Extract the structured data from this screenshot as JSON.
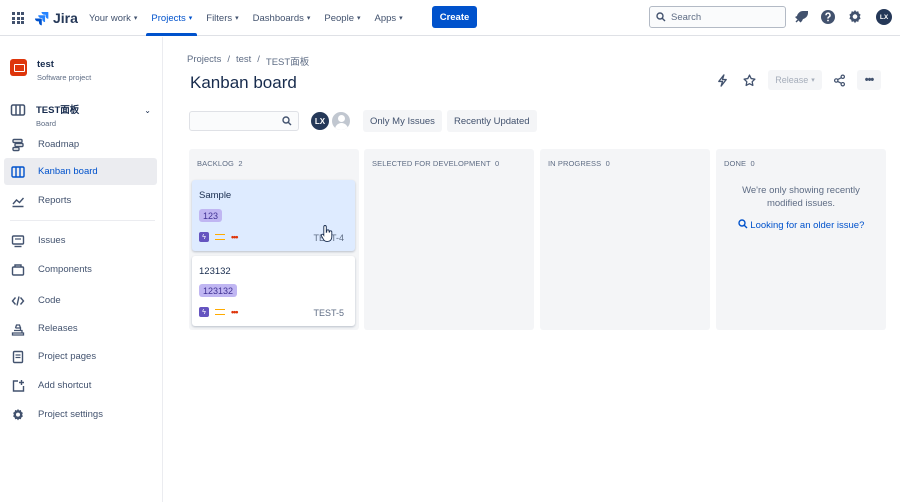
{
  "topbar": {
    "logo_text": "Jira",
    "nav": [
      {
        "label": "Your work",
        "active": false
      },
      {
        "label": "Projects",
        "active": true
      },
      {
        "label": "Filters",
        "active": false
      },
      {
        "label": "Dashboards",
        "active": false
      },
      {
        "label": "People",
        "active": false
      },
      {
        "label": "Apps",
        "active": false
      }
    ],
    "create_label": "Create",
    "search_placeholder": "Search",
    "avatar_initials": "LX"
  },
  "sidebar": {
    "project_name": "test",
    "project_type": "Software project",
    "board_name": "TEST面板",
    "board_type": "Board",
    "items": [
      {
        "label": "Roadmap",
        "icon": "roadmap-icon",
        "active": false
      },
      {
        "label": "Kanban board",
        "icon": "board-icon",
        "active": true
      },
      {
        "label": "Reports",
        "icon": "reports-icon",
        "active": false
      },
      {
        "label": "Issues",
        "icon": "issues-icon",
        "active": false
      },
      {
        "label": "Components",
        "icon": "components-icon",
        "active": false
      },
      {
        "label": "Code",
        "icon": "code-icon",
        "active": false
      },
      {
        "label": "Releases",
        "icon": "releases-icon",
        "active": false
      },
      {
        "label": "Project pages",
        "icon": "pages-icon",
        "active": false
      },
      {
        "label": "Add shortcut",
        "icon": "add-shortcut-icon",
        "active": false
      },
      {
        "label": "Project settings",
        "icon": "settings-icon",
        "active": false
      }
    ]
  },
  "breadcrumb": [
    "Projects",
    "test",
    "TEST面板"
  ],
  "page_title": "Kanban board",
  "header_actions": {
    "release_label": "Release"
  },
  "filters": {
    "avatar_initials": "LX",
    "only_my_issues": "Only My Issues",
    "recently_updated": "Recently Updated"
  },
  "columns": [
    {
      "title": "Backlog",
      "count": "2",
      "cards": [
        {
          "summary": "Sample",
          "label": "123",
          "key": "TEST-4",
          "hover": true
        },
        {
          "summary": "123132",
          "label": "123132",
          "key": "TEST-5",
          "hover": false
        }
      ]
    },
    {
      "title": "Selected for Development",
      "count": "0",
      "cards": []
    },
    {
      "title": "In Progress",
      "count": "0",
      "cards": []
    },
    {
      "title": "Done",
      "count": "0",
      "cards": [],
      "message": "We're only showing recently modified issues.",
      "link": "Looking for an older issue?"
    }
  ],
  "colors": {
    "brand": "#0052cc",
    "label_bg": "#c0b6f2",
    "story_type": "#6554c0",
    "priority": "#ffab00"
  }
}
